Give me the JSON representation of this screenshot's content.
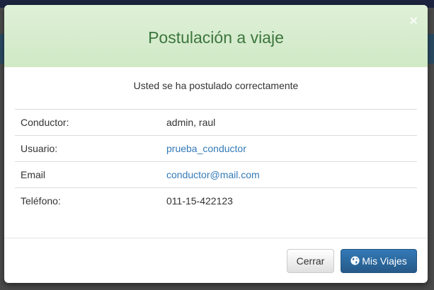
{
  "modal": {
    "title": "Postulación a viaje",
    "close_label": "×",
    "message": "Usted se ha postulado correctamente",
    "rows": [
      {
        "label": "Conductor:",
        "value": "admin, raul",
        "link": false
      },
      {
        "label": "Usuario:",
        "value": "prueba_conductor",
        "link": true
      },
      {
        "label": "Email",
        "value": "conductor@mail.com",
        "link": true
      },
      {
        "label": "Teléfono:",
        "value": "011-15-422123",
        "link": false
      }
    ],
    "buttons": {
      "cancel_label": "Cerrar",
      "primary_label": "Mis Viajes",
      "primary_icon": "globe-icon"
    }
  },
  "colors": {
    "header_bg": "#dff0d8",
    "title_color": "#3c763d",
    "link_color": "#337ab7",
    "primary_button": "#337ab7"
  }
}
